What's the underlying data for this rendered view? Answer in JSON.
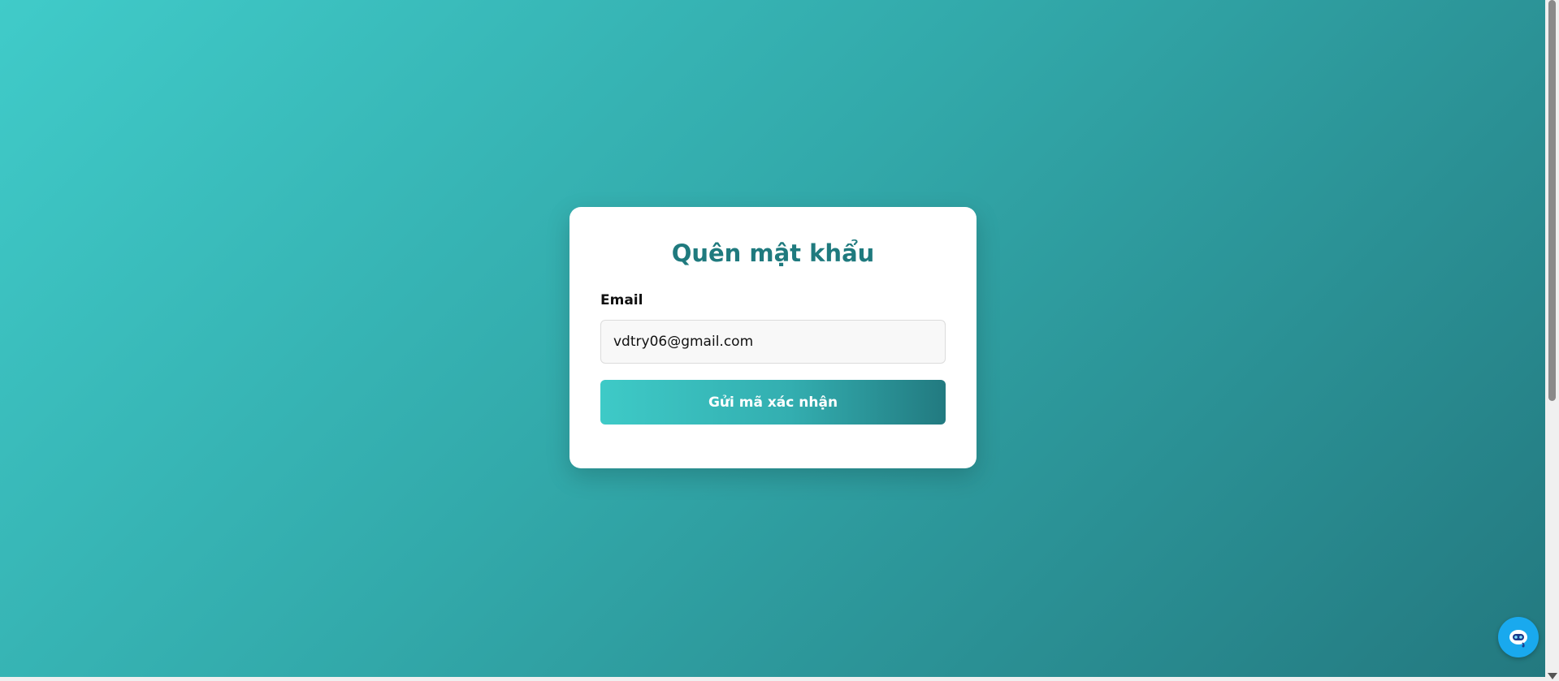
{
  "form": {
    "title": "Quên mật khẩu",
    "email_label": "Email",
    "email_value": "vdtry06@gmail.com",
    "submit_label": "Gửi mã xác nhận"
  },
  "chat": {
    "icon": "chatbot-icon"
  },
  "colors": {
    "title": "#1f7a7e",
    "accent_light": "#40cbc9",
    "accent_dark": "#23787f",
    "chat_button": "#19a9ee"
  }
}
